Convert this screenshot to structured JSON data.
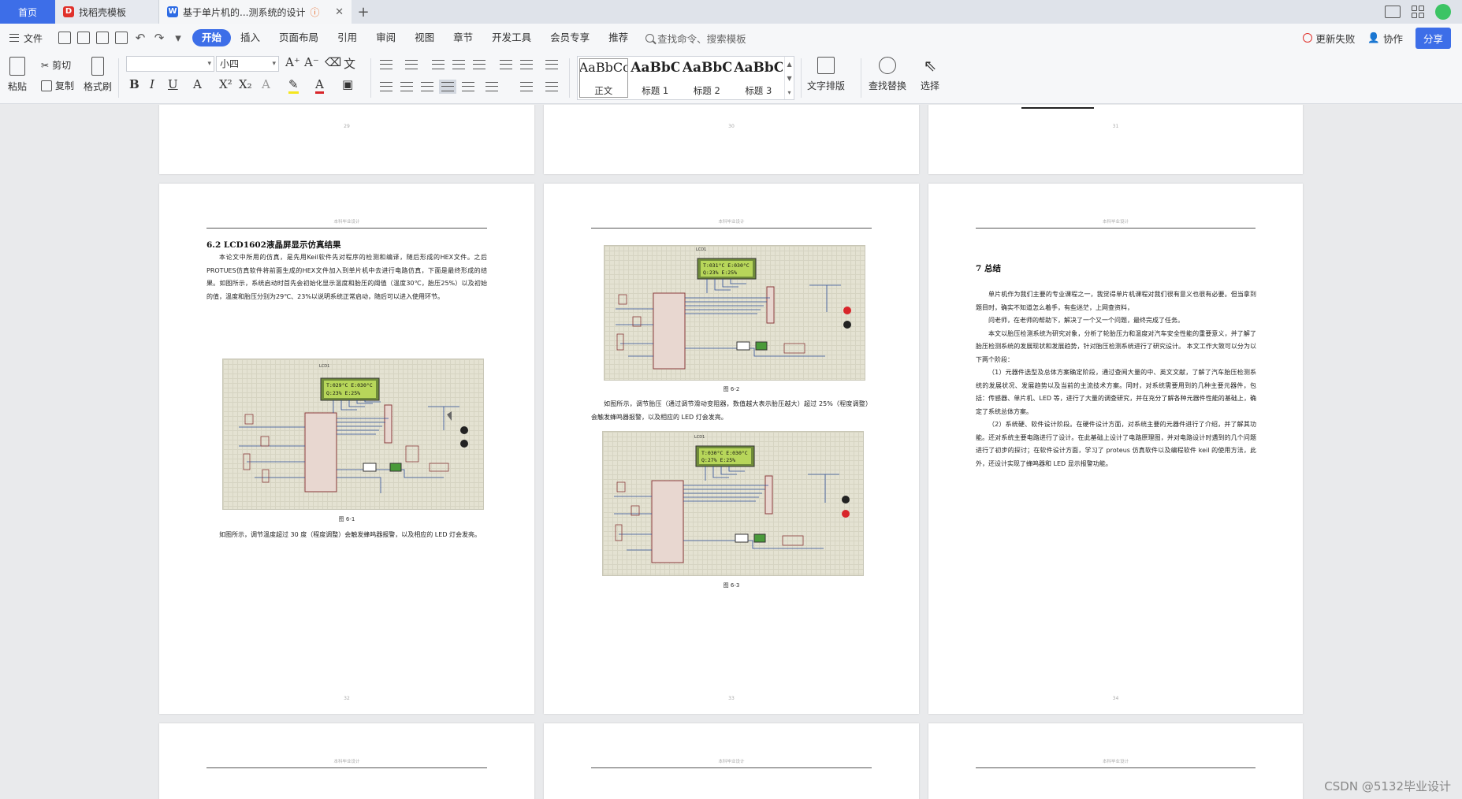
{
  "tabs": {
    "home": "首页",
    "template": "找稻壳模板",
    "doc": "基于单片机的...测系统的设计",
    "close": "✕",
    "add": "+"
  },
  "menu": {
    "file": "文件",
    "items": [
      "开始",
      "插入",
      "页面布局",
      "引用",
      "审阅",
      "视图",
      "章节",
      "开发工具",
      "会员专享",
      "推荐"
    ],
    "search": "查找命令、搜索模板",
    "update_fail": "更新失败",
    "collab": "协作",
    "share": "分享"
  },
  "ribbon": {
    "paste": "粘贴",
    "cut": "剪切",
    "copy": "复制",
    "format_painter": "格式刷",
    "font_name": "",
    "font_size": "小四",
    "styles": [
      {
        "sample": "AaBbCcI",
        "name": "正文"
      },
      {
        "sample": "AaBbC",
        "name": "标题 1"
      },
      {
        "sample": "AaBbC",
        "name": "标题 2"
      },
      {
        "sample": "AaBbC",
        "name": "标题 3"
      }
    ],
    "text_layout": "文字排版",
    "find_replace": "查找替换",
    "select": "选择"
  },
  "pages": {
    "p29": "29",
    "p30": "30",
    "p31": "31",
    "p32": "32",
    "p33": "33",
    "p34": "34",
    "header": "本科毕业设计",
    "left": {
      "heading": "6.2   LCD1602液晶屏显示仿真结果",
      "para1": "本论文中所用的仿真，是先用Keil软件先对程序的检测和编译，随后形成的HEX文件。之后PROTUES仿真软件将前面生成的HEX文件加入到单片机中去进行电路仿真，下面是最终形成的结果。如图所示，系统启动时首先会初始化显示温度和胎压的阈值（温度30℃，胎压25%）以及初始的值，温度和胎压分别为29℃、23%以说明系统正常启动，随后可以进入使用环节。",
      "caption": "图 6-1",
      "para2": "如图所示，调节温度超过 30 度（程度调整）会触发蜂鸣器报警，以及相应的 LED 灯会发亮。",
      "lcd_line1": "T:029°C  E:030°C",
      "lcd_line2": "Q:23%     E:25%"
    },
    "mid": {
      "caption1": "图 6-2",
      "para": "如图所示，调节胎压（通过调节滑动变阻器，数值越大表示胎压越大）超过 25%（程度调整）会触发蜂鸣器报警，以及相应的 LED 灯会发亮。",
      "caption2": "图 6-3",
      "lcd1_line1": "T:031°C  E:030°C",
      "lcd1_line2": "Q:23%     E:25%",
      "lcd2_line1": "T:030°C  E:030°C",
      "lcd2_line2": "Q:27%     E:25%"
    },
    "right": {
      "heading": "7   总结",
      "para1": "单片机作为我们主要的专业课程之一，我觉得单片机课程对我们很有意义也很有必要。但当拿到题目时，确实不知道怎么着手，有些迷茫，上网查资料，",
      "para2": "问老师，在老师的帮助下，解决了一个又一个问题，最终完成了任务。",
      "para3": "本文以胎压检测系统为研究对象，分析了轮胎压力和温度对汽车安全性能的重要意义，并了解了胎压检测系统的发展现状和发展趋势，针对胎压检测系统进行了研究设计。 本文工作大致可以分为以下两个阶段：",
      "para4": "（1）元器件选型及总体方案确定阶段，通过查阅大量的中、英文文献，了解了汽车胎压检测系统的发展状况、发展趋势以及当前的主流技术方案。同时，对系统需要用到的几种主要元器件，包括：传感器、单片机、LED 等，进行了大量的调查研究，并在充分了解各种元器件性能的基础上，确定了系统总体方案。",
      "para5": "（2）系统硬、软件设计阶段。在硬件设计方面，对系统主要的元器件进行了介绍，并了解其功能。还对系统主要电路进行了设计。在此基础上设计了电路原理图，并对电路设计时遇到的几个问题进行了初步的探讨；在软件设计方面，学习了 proteus 仿真软件以及编程软件 keil 的使用方法，此外，还设计实现了蜂鸣器和 LED 显示报警功能。"
    },
    "schematic": {
      "lcd_label": "LCD1"
    }
  },
  "watermark": "CSDN @5132毕业设计",
  "colors": {
    "accent": "#3d6ee8",
    "tab_bar": "#dfe3ea",
    "ribbon_bg": "#f6f7f9",
    "doc_bg": "#e9eaec"
  }
}
